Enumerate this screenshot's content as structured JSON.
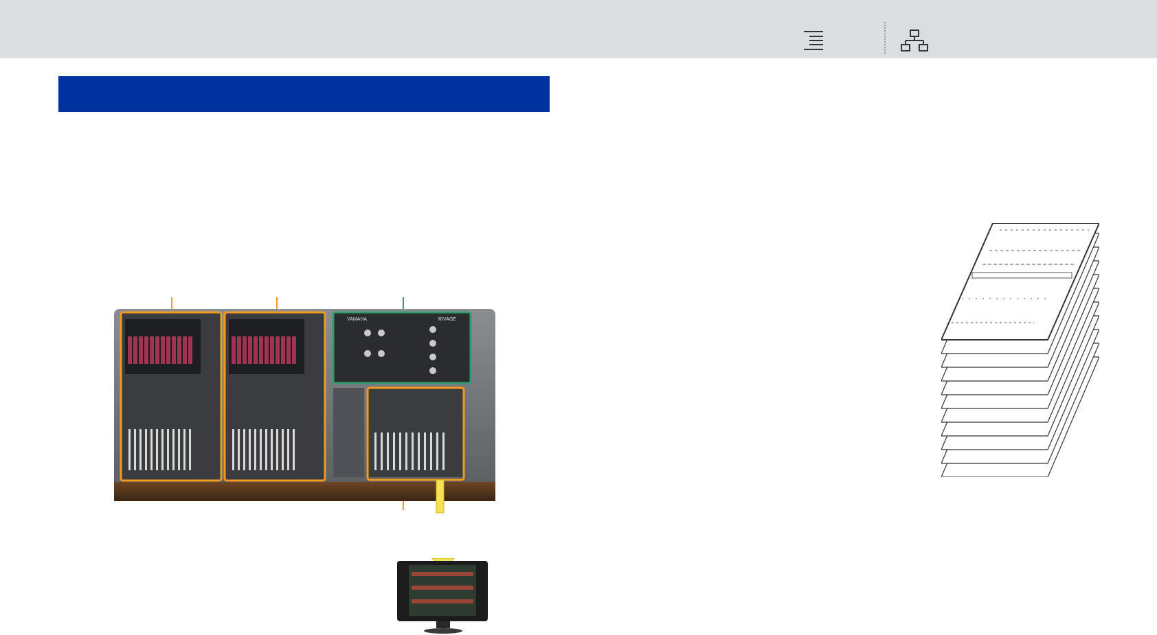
{
  "header": {
    "toc_icon": "toc-list-icon",
    "network_icon": "network-tree-icon"
  },
  "section": {
    "title": ""
  },
  "figure": {
    "console_label": "YAMAHA",
    "console_model": "RIVAGE",
    "console_label_colors": {
      "bay": "#f39a1e",
      "selected_fader": "#f39a1e",
      "touch_screen": "#2e9e6e"
    },
    "arrow_color": "#f5e05a",
    "fader_count_per_bay": 12,
    "layer_count": 12
  },
  "colors": {
    "header_bg": "#dcdddf",
    "accent": "#0033a0"
  }
}
